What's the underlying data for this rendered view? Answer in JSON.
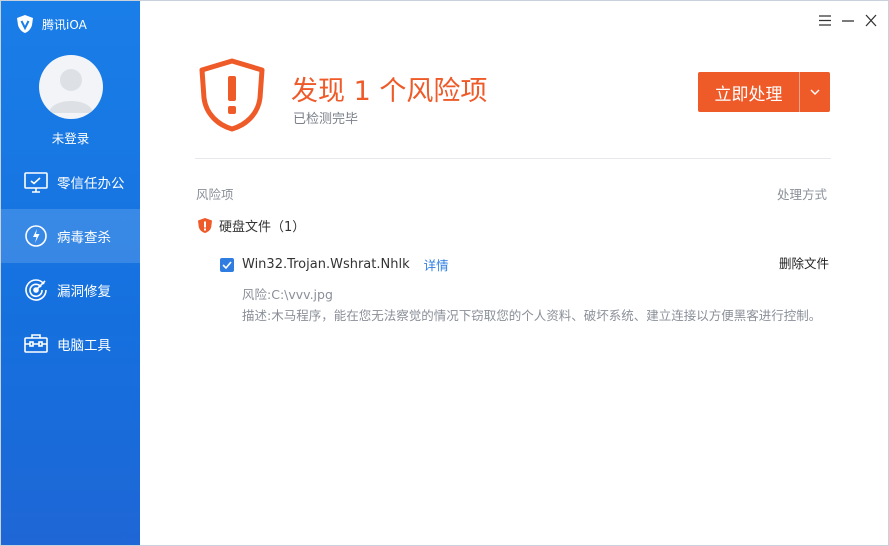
{
  "app": {
    "title": "腾讯iOA"
  },
  "user": {
    "label": "未登录"
  },
  "nav": {
    "items": [
      {
        "label": "零信任办公",
        "icon": "monitor-icon",
        "active": false
      },
      {
        "label": "病毒查杀",
        "icon": "virus-scan-icon",
        "active": true
      },
      {
        "label": "漏洞修复",
        "icon": "vulnerability-icon",
        "active": false
      },
      {
        "label": "电脑工具",
        "icon": "toolbox-icon",
        "active": false
      }
    ]
  },
  "result": {
    "title": "发现 1 个风险项",
    "subtitle": "已检测完毕",
    "action_label": "立即处理"
  },
  "table": {
    "col_risk": "风险项",
    "col_method": "处理方式",
    "group_label": "硬盘文件（1）",
    "item": {
      "name": "Win32.Trojan.Wshrat.Nhlk",
      "detail_link": "详情",
      "action": "删除文件",
      "path": "风险:C:\\vvv.jpg",
      "description": "描述:木马程序，能在您无法察觉的情况下窃取您的个人资料、破坏系统、建立连接以方便黑客进行控制。",
      "checked": true
    }
  },
  "colors": {
    "sidebar": "#1a7ee8",
    "accent": "#ef5a29",
    "link": "#2f7de1"
  }
}
